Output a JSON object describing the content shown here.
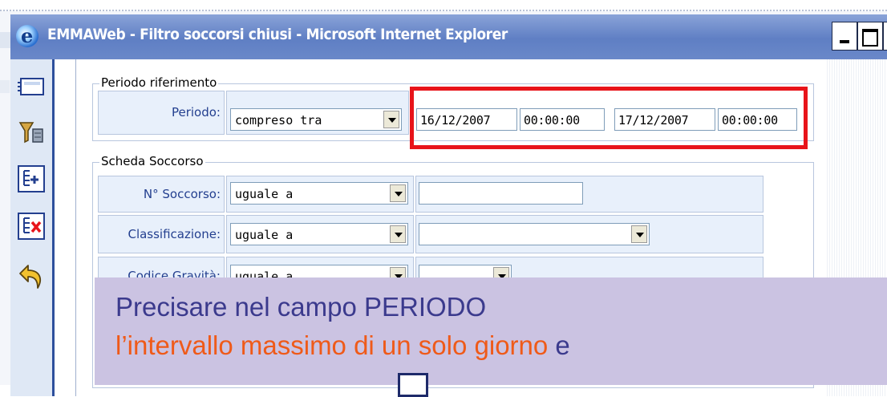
{
  "window": {
    "title": "EMMAWeb - Filtro soccorsi chiusi - Microsoft Internet Explorer",
    "controls": {
      "minimize": "_",
      "maximize": "□",
      "close": "×"
    }
  },
  "toolbar": {
    "items": [
      {
        "icon": "card-icon"
      },
      {
        "icon": "filter-icon"
      },
      {
        "icon": "add-criteria-icon"
      },
      {
        "icon": "remove-criteria-icon"
      },
      {
        "icon": "undo-icon"
      }
    ]
  },
  "periodo": {
    "legend": "Periodo riferimento",
    "label": "Periodo:",
    "operator": "compreso tra",
    "from_date": "16/12/2007",
    "from_time": "00:00:00",
    "to_date": "17/12/2007",
    "to_time": "00:00:00",
    "highlight_color": "#e8141a"
  },
  "scheda": {
    "legend": "Scheda Soccorso",
    "rows": [
      {
        "label": "N° Soccorso:",
        "operator": "uguale a",
        "value": ""
      },
      {
        "label": "Classificazione:",
        "operator": "uguale a",
        "value": ""
      },
      {
        "label": "Codice Gravità:",
        "operator": "uguale a",
        "value": ""
      }
    ]
  },
  "caption": {
    "line1": "Precisare nel campo PERIODO",
    "line2_highlight": "l’intervallo massimo di un solo giorno",
    "line2_tail": "e"
  }
}
